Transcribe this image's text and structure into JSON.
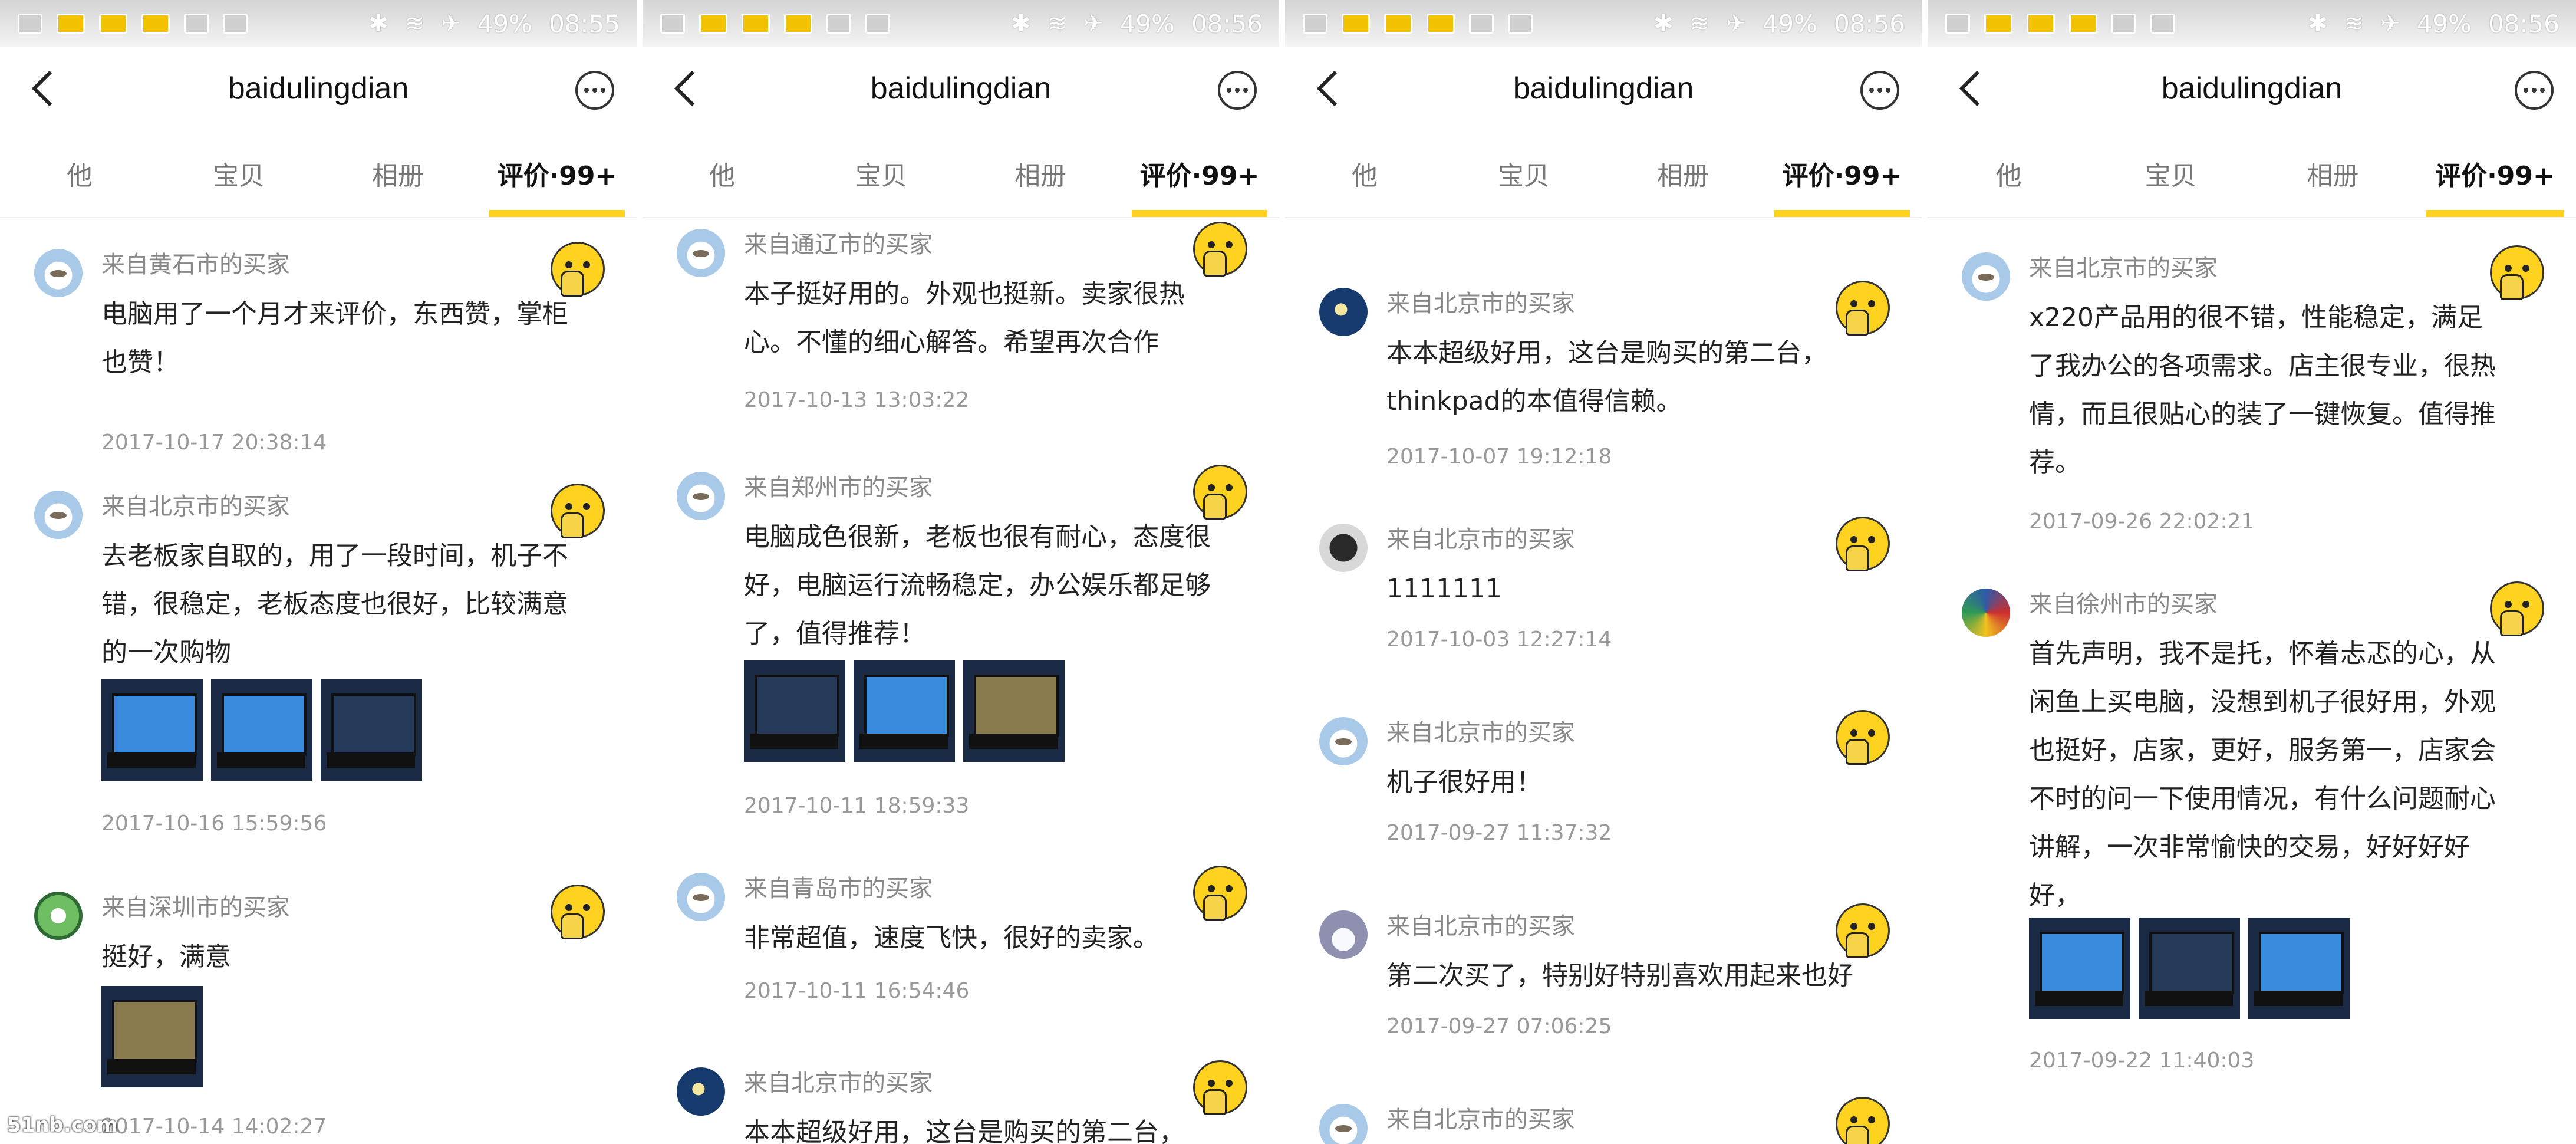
{
  "status_bar": {
    "battery": "49%",
    "time": "08:55",
    "time_2": "08:56"
  },
  "app": {
    "title": "baidulingdian",
    "tabs": [
      "他",
      "宝贝",
      "相册",
      "评价·99+"
    ]
  },
  "icons": [
    "back-icon",
    "more-icon",
    "emoji-thumb-icon",
    "wifi-icon",
    "bluetooth-icon",
    "airplane-icon"
  ],
  "colors": {
    "accent": "#ffd21f",
    "text": "#222222",
    "muted": "#888888"
  },
  "panels": [
    {
      "reviews": [
        {
          "buyer": "来自黄石市的买家",
          "text": "电脑用了一个月才来评价，东西赞，掌柜也赞！",
          "date": "2017-10-17 20:38:14"
        },
        {
          "buyer": "来自北京市的买家",
          "text": "去老板家自取的，用了一段时间，机子不错，很稳定，老板态度也很好，比较满意的一次购物",
          "date": "2017-10-16 15:59:56"
        },
        {
          "buyer": "来自深圳市的买家",
          "text": "挺好，满意",
          "date": "2017-10-14 14:02:27"
        }
      ]
    },
    {
      "reviews": [
        {
          "buyer": "来自通辽市的买家",
          "text": "本子挺好用的。外观也挺新。卖家很热心。不懂的细心解答。希望再次合作",
          "date": "2017-10-13 13:03:22"
        },
        {
          "buyer": "来自郑州市的买家",
          "text": "电脑成色很新，老板也很有耐心，态度很好，电脑运行流畅稳定，办公娱乐都足够了，值得推荐！",
          "date": "2017-10-11 18:59:33"
        },
        {
          "buyer": "来自青岛市的买家",
          "text": "非常超值，速度飞快，很好的卖家。",
          "date": "2017-10-11 16:54:46"
        },
        {
          "buyer": "来自北京市的买家",
          "text": "本本超级好用，这台是购买的第二台，"
        }
      ]
    },
    {
      "reviews": [
        {
          "buyer": "来自北京市的买家",
          "text": "本本超级好用，这台是购买的第二台，thinkpad的本值得信赖。",
          "date": "2017-10-07 19:12:18"
        },
        {
          "buyer": "来自北京市的买家",
          "text": "1111111",
          "date": "2017-10-03 12:27:14"
        },
        {
          "buyer": "来自北京市的买家",
          "text": "机子很好用！",
          "date": "2017-09-27 11:37:32"
        },
        {
          "buyer": "来自北京市的买家",
          "text": "第二次买了，特别好特别喜欢用起来也好",
          "date": "2017-09-27 07:06:25"
        },
        {
          "buyer": "来自北京市的买家"
        }
      ]
    },
    {
      "reviews": [
        {
          "buyer": "来自北京市的买家",
          "text": "x220产品用的很不错，性能稳定，满足了我办公的各项需求。店主很专业，很热情，而且很贴心的装了一键恢复。值得推荐。",
          "date": "2017-09-26 22:02:21"
        },
        {
          "buyer": "来自徐州市的买家",
          "text": "首先声明，我不是托，怀着忐忑的心，从闲鱼上买电脑，没想到机子很好用，外观也挺好，店家，更好，服务第一，店家会不时的问一下使用情况，有什么问题耐心讲解，一次非常愉快的交易，好好好好好，",
          "date": "2017-09-22 11:40:03"
        }
      ]
    }
  ],
  "watermark": "51nb.com"
}
